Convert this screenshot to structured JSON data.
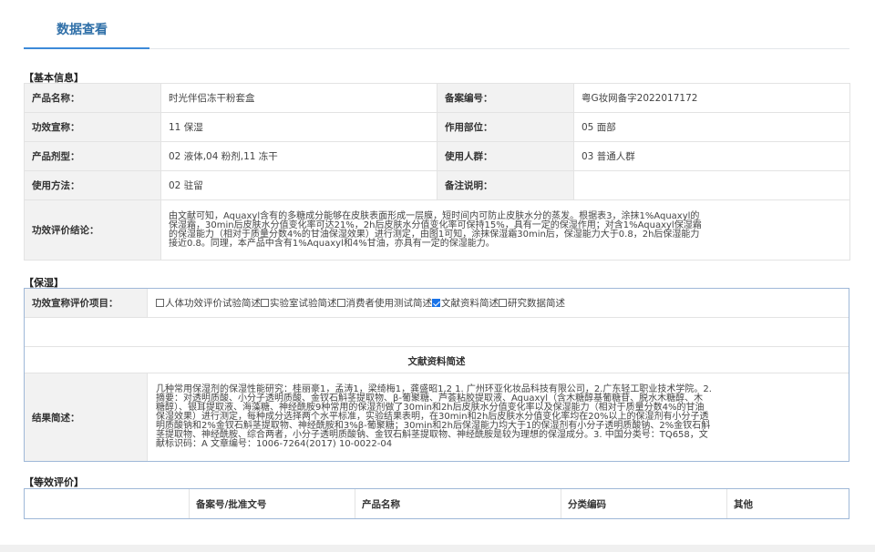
{
  "tab": {
    "label": "数据查看"
  },
  "basic": {
    "section_title": "【基本信息】",
    "rows": [
      {
        "l1": "产品名称：",
        "v1": "时光伴侣冻干粉套盒",
        "l2": "备案编号：",
        "v2": "粤G妆网备字2022017172"
      },
      {
        "l1": "功效宣称：",
        "v1": "11 保湿",
        "l2": "作用部位：",
        "v2": "05 面部"
      },
      {
        "l1": "产品剂型：",
        "v1": "02 液体,04 粉剂,11 冻干",
        "l2": "使用人群：",
        "v2": "03 普通人群"
      },
      {
        "l1": "使用方法：",
        "v1": "02 驻留",
        "l2": "备注说明：",
        "v2": ""
      }
    ],
    "conclusion_label": "功效评价结论：",
    "conclusion_text": "由文献可知，Aquaxyl含有的多糖成分能够在皮肤表面形成一层膜，短时间内可防止皮肤水分的蒸发。根据表3，涂抹1%Aquaxyl的保湿霜，30min后皮肤水分值变化率可达21%，2h后皮肤水分值变化率可保持15%，具有一定的保湿作用；对含1%Aquaxyl保湿霜的保湿能力（相对于质量分数4%的甘油保湿效果）进行测定，由图1可知，涂抹保湿霜30min后，保湿能力大于0.8，2h后保湿能力接近0.8。同理，本产品中含有1%Aquaxyl和4%甘油，亦具有一定的保湿能力。"
  },
  "moist": {
    "section_title": "【保湿】",
    "items_label": "功效宣称评价项目：",
    "checkboxes": [
      {
        "label": "人体功效评价试验简述",
        "checked": false
      },
      {
        "label": "实验室试验简述",
        "checked": false
      },
      {
        "label": "消费者使用测试简述",
        "checked": false
      },
      {
        "label": "文献资料简述",
        "checked": true
      },
      {
        "label": "研究数据简述",
        "checked": false
      }
    ],
    "lit_title": "文献资料简述",
    "result_label": "结果简述：",
    "result_text": "几种常用保湿剂的保湿性能研究：桂丽豪1，孟涛1，梁绮梅1，龚盛昭1,2 1. 广州环亚化妆品科技有限公司，2.广东轻工职业技术学院。2. 摘要：对透明质酸、小分子透明质酸、金钗石斛茎提取物、β-葡聚糖、芦荟粘胶提取液、Aquaxyl（含木糖醇基葡糖苷、脱水木糖醇、木糖醇）、银耳提取液、海藻糖、神经酰胺9种常用的保湿剂做了30min和2h后皮肤水分值变化率以及保湿能力（相对于质量分数4%的甘油保湿效果）进行测定，每种成分选择两个水平标准，实验结果表明，在30min和2h后皮肤水分值变化率均在20%以上的保湿剂有小分子透明质酸钠和2%金钗石斛茎提取物、神经酰胺和3%β-葡聚糖；30min和2h后保湿能力均大于1的保湿剂有小分子透明质酸钠、2%金钗石斛茎提取物、神经酰胺、综合两者，小分子透明质酸钠、金钗石斛茎提取物、神经酰胺是较为理想的保湿成分。3. 中国分类号：TQ658，文献标识码：A 文章编号：1006-7264(2017) 10-0022-04"
  },
  "equiv": {
    "section_title": "【等效评价】",
    "headers": [
      "备案号/批准文号",
      "产品名称",
      "分类编码",
      "其他"
    ]
  }
}
